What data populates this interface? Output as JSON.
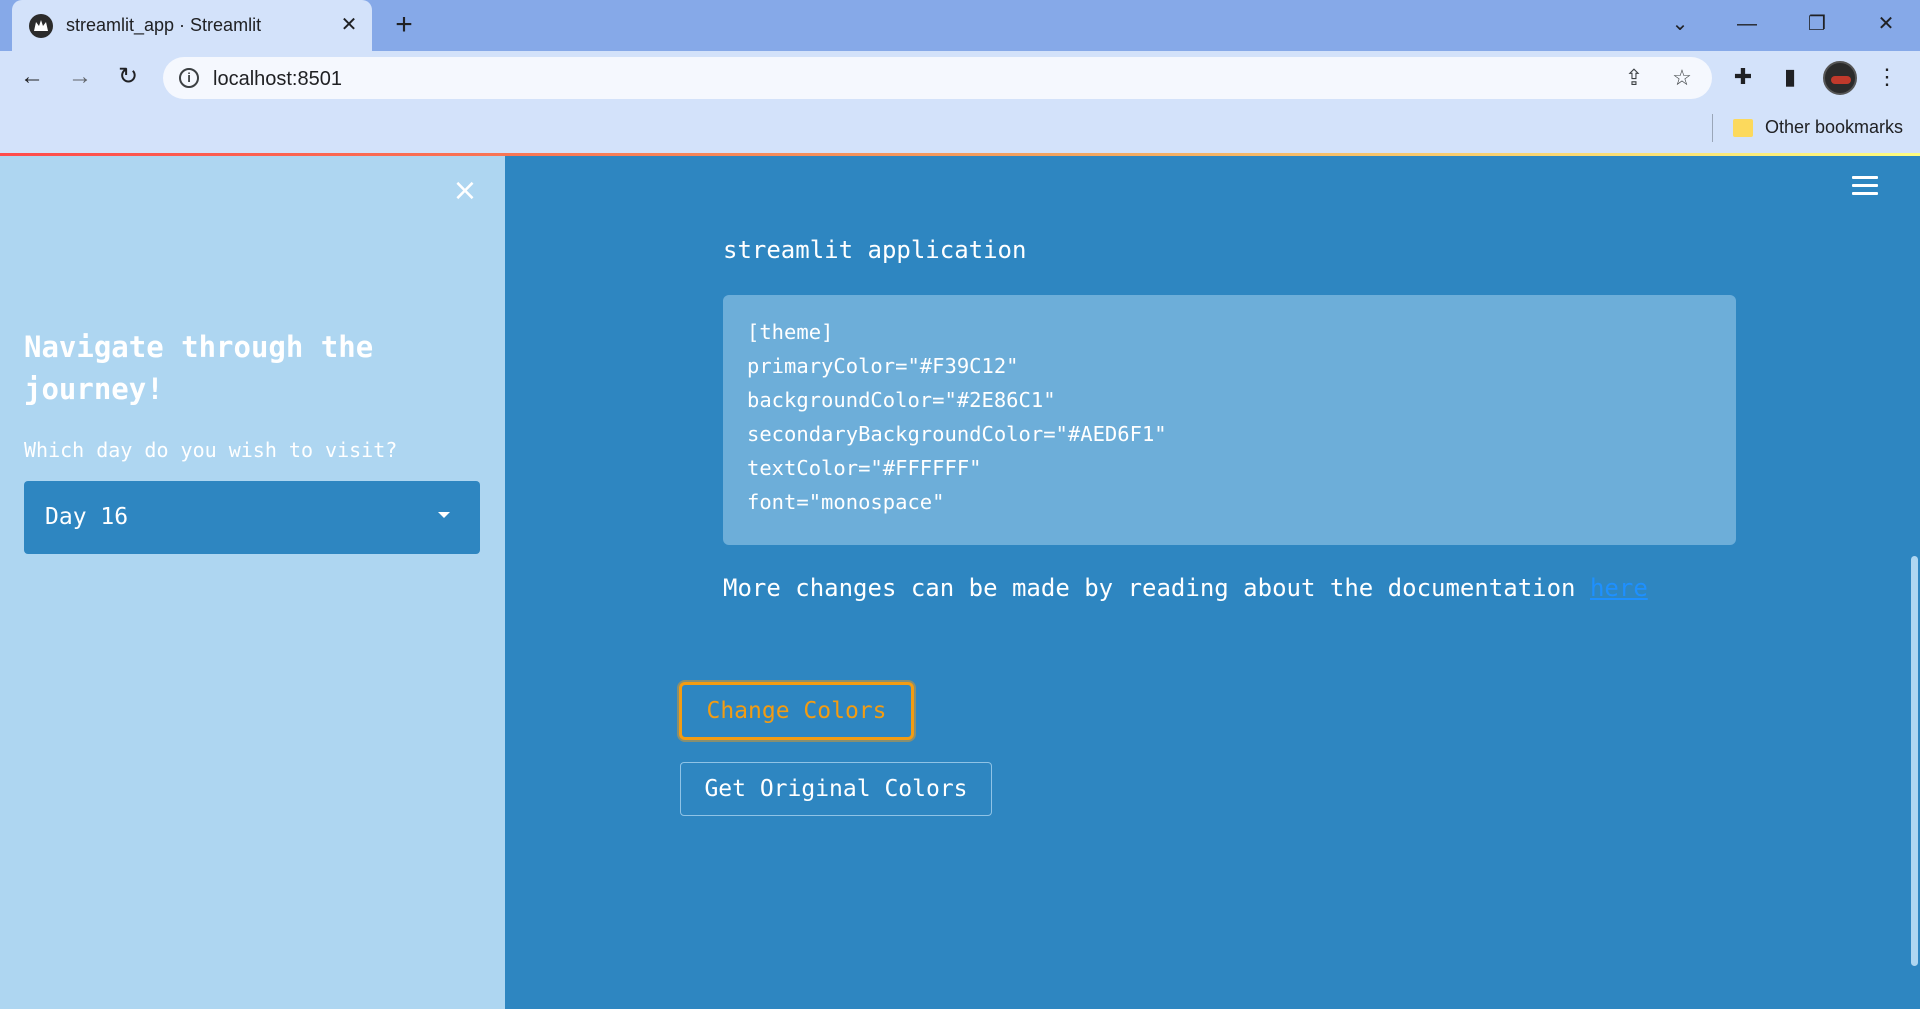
{
  "browser": {
    "tab_title": "streamlit_app · Streamlit",
    "url": "localhost:8501",
    "bookmarks_label": "Other bookmarks"
  },
  "sidebar": {
    "title": "Navigate through the journey!",
    "select_label": "Which day do you wish to visit?",
    "select_value": "Day 16"
  },
  "main": {
    "para_end": "streamlit application",
    "code_lines": [
      "[theme]",
      "primaryColor=\"#F39C12\"",
      "backgroundColor=\"#2E86C1\"",
      "secondaryBackgroundColor=\"#AED6F1\"",
      "textColor=\"#FFFFFF\"",
      "font=\"monospace\""
    ],
    "more_text": "More changes can be made by reading about the documentation",
    "link_text": "here",
    "change_button": "Change Colors",
    "original_button": "Get Original Colors"
  },
  "colors": {
    "primary": "#F39C12",
    "background": "#2E86C1",
    "secondary_background": "#AED6F1",
    "text": "#FFFFFF"
  }
}
